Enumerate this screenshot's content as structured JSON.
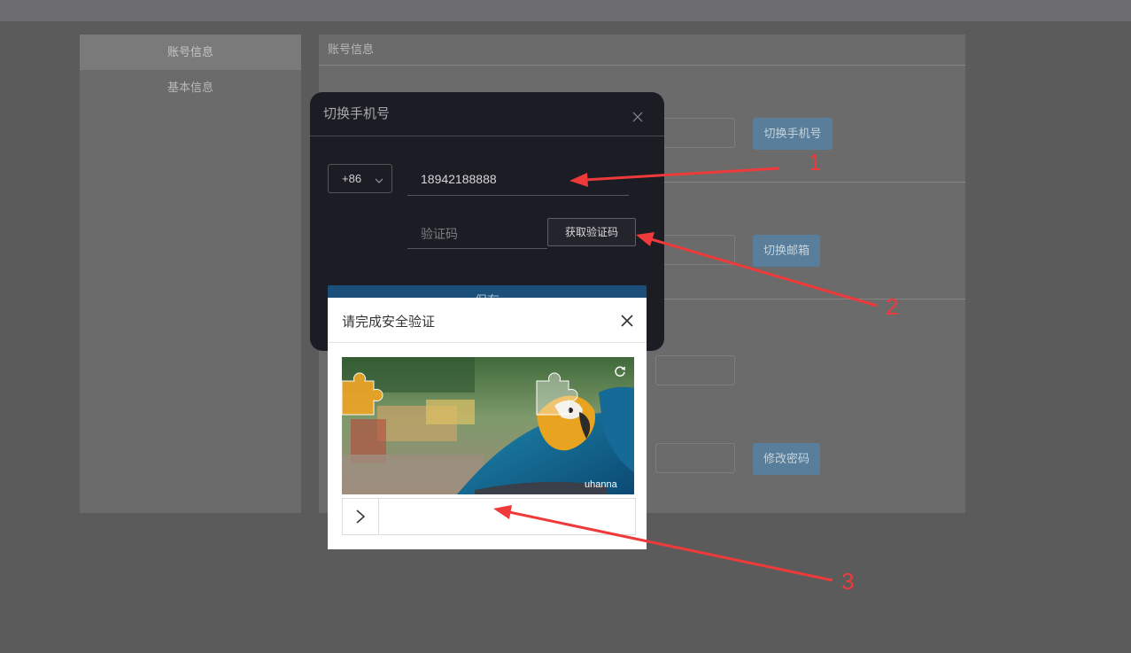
{
  "sidebar": {
    "items": [
      {
        "label": "账号信息",
        "active": true
      },
      {
        "label": "基本信息",
        "active": false
      }
    ]
  },
  "panel": {
    "title": "账号信息",
    "buttons": {
      "switch_phone": "切换手机号",
      "switch_email": "切换邮箱",
      "change_password": "修改密码"
    }
  },
  "phone_dialog": {
    "title": "切换手机号",
    "country_code": "+86",
    "phone_value": "18942188888",
    "code_placeholder": "验证码",
    "get_code_label": "获取验证码",
    "save_label": "保存"
  },
  "captcha": {
    "title": "请完成安全验证",
    "watermark": "uhanna"
  },
  "annotations": [
    "1",
    "2",
    "3"
  ],
  "colors": {
    "annotation_red": "#ee3a3a",
    "dialog_bg": "#1c1c24",
    "save_blue": "#1b4f7a",
    "bg_button": "#587e9b"
  }
}
